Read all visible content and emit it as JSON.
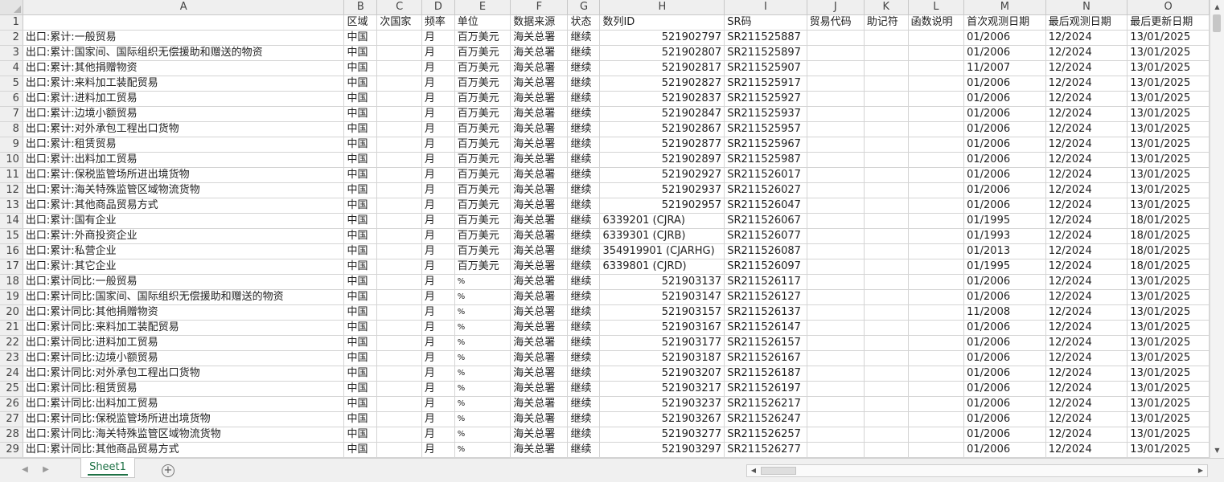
{
  "columns": [
    {
      "letter": "A",
      "header": ""
    },
    {
      "letter": "B",
      "header": "区域"
    },
    {
      "letter": "C",
      "header": "次国家"
    },
    {
      "letter": "D",
      "header": "频率"
    },
    {
      "letter": "E",
      "header": "单位"
    },
    {
      "letter": "F",
      "header": "数据来源"
    },
    {
      "letter": "G",
      "header": "状态"
    },
    {
      "letter": "H",
      "header": "数列ID"
    },
    {
      "letter": "I",
      "header": "SR码"
    },
    {
      "letter": "J",
      "header": "贸易代码"
    },
    {
      "letter": "K",
      "header": "助记符"
    },
    {
      "letter": "L",
      "header": "函数说明"
    },
    {
      "letter": "M",
      "header": "首次观测日期"
    },
    {
      "letter": "N",
      "header": "最后观测日期"
    },
    {
      "letter": "O",
      "header": "最后更新日期"
    }
  ],
  "rows": [
    {
      "n": "2",
      "name": "出口:累计:一般贸易",
      "unit": "百万美元",
      "id": "521902797",
      "sr": "SR211525887",
      "first": "01/2006",
      "updated": "13/01/2025"
    },
    {
      "n": "3",
      "name": "出口:累计:国家间、国际组织无偿援助和赠送的物资",
      "unit": "百万美元",
      "id": "521902807",
      "sr": "SR211525897",
      "first": "01/2006",
      "updated": "13/01/2025"
    },
    {
      "n": "4",
      "name": "出口:累计:其他捐赠物资",
      "unit": "百万美元",
      "id": "521902817",
      "sr": "SR211525907",
      "first": "11/2007",
      "updated": "13/01/2025"
    },
    {
      "n": "5",
      "name": "出口:累计:来料加工装配贸易",
      "unit": "百万美元",
      "id": "521902827",
      "sr": "SR211525917",
      "first": "01/2006",
      "updated": "13/01/2025"
    },
    {
      "n": "6",
      "name": "出口:累计:进料加工贸易",
      "unit": "百万美元",
      "id": "521902837",
      "sr": "SR211525927",
      "first": "01/2006",
      "updated": "13/01/2025"
    },
    {
      "n": "7",
      "name": "出口:累计:边境小额贸易",
      "unit": "百万美元",
      "id": "521902847",
      "sr": "SR211525937",
      "first": "01/2006",
      "updated": "13/01/2025"
    },
    {
      "n": "8",
      "name": "出口:累计:对外承包工程出口货物",
      "unit": "百万美元",
      "id": "521902867",
      "sr": "SR211525957",
      "first": "01/2006",
      "updated": "13/01/2025"
    },
    {
      "n": "9",
      "name": "出口:累计:租赁贸易",
      "unit": "百万美元",
      "id": "521902877",
      "sr": "SR211525967",
      "first": "01/2006",
      "updated": "13/01/2025"
    },
    {
      "n": "10",
      "name": "出口:累计:出料加工贸易",
      "unit": "百万美元",
      "id": "521902897",
      "sr": "SR211525987",
      "first": "01/2006",
      "updated": "13/01/2025"
    },
    {
      "n": "11",
      "name": "出口:累计:保税监管场所进出境货物",
      "unit": "百万美元",
      "id": "521902927",
      "sr": "SR211526017",
      "first": "01/2006",
      "updated": "13/01/2025"
    },
    {
      "n": "12",
      "name": "出口:累计:海关特殊监管区域物流货物",
      "unit": "百万美元",
      "id": "521902937",
      "sr": "SR211526027",
      "first": "01/2006",
      "updated": "13/01/2025"
    },
    {
      "n": "13",
      "name": "出口:累计:其他商品贸易方式",
      "unit": "百万美元",
      "id": "521902957",
      "sr": "SR211526047",
      "first": "01/2006",
      "updated": "13/01/2025"
    },
    {
      "n": "14",
      "name": "出口:累计:国有企业",
      "unit": "百万美元",
      "id": "6339201 (CJRA)",
      "sr": "SR211526067",
      "first": "01/1995",
      "updated": "18/01/2025"
    },
    {
      "n": "15",
      "name": "出口:累计:外商投资企业",
      "unit": "百万美元",
      "id": "6339301 (CJRB)",
      "sr": "SR211526077",
      "first": "01/1993",
      "updated": "18/01/2025"
    },
    {
      "n": "16",
      "name": "出口:累计:私营企业",
      "unit": "百万美元",
      "id": "354919901 (CJARHG)",
      "sr": "SR211526087",
      "first": "01/2013",
      "updated": "18/01/2025"
    },
    {
      "n": "17",
      "name": "出口:累计:其它企业",
      "unit": "百万美元",
      "id": "6339801 (CJRD)",
      "sr": "SR211526097",
      "first": "01/1995",
      "updated": "18/01/2025"
    },
    {
      "n": "18",
      "name": "出口:累计同比:一般贸易",
      "unit": "%",
      "id": "521903137",
      "sr": "SR211526117",
      "first": "01/2006",
      "updated": "13/01/2025"
    },
    {
      "n": "19",
      "name": "出口:累计同比:国家间、国际组织无偿援助和赠送的物资",
      "unit": "%",
      "id": "521903147",
      "sr": "SR211526127",
      "first": "01/2006",
      "updated": "13/01/2025"
    },
    {
      "n": "20",
      "name": "出口:累计同比:其他捐赠物资",
      "unit": "%",
      "id": "521903157",
      "sr": "SR211526137",
      "first": "11/2008",
      "updated": "13/01/2025"
    },
    {
      "n": "21",
      "name": "出口:累计同比:来料加工装配贸易",
      "unit": "%",
      "id": "521903167",
      "sr": "SR211526147",
      "first": "01/2006",
      "updated": "13/01/2025"
    },
    {
      "n": "22",
      "name": "出口:累计同比:进料加工贸易",
      "unit": "%",
      "id": "521903177",
      "sr": "SR211526157",
      "first": "01/2006",
      "updated": "13/01/2025"
    },
    {
      "n": "23",
      "name": "出口:累计同比:边境小额贸易",
      "unit": "%",
      "id": "521903187",
      "sr": "SR211526167",
      "first": "01/2006",
      "updated": "13/01/2025"
    },
    {
      "n": "24",
      "name": "出口:累计同比:对外承包工程出口货物",
      "unit": "%",
      "id": "521903207",
      "sr": "SR211526187",
      "first": "01/2006",
      "updated": "13/01/2025"
    },
    {
      "n": "25",
      "name": "出口:累计同比:租赁贸易",
      "unit": "%",
      "id": "521903217",
      "sr": "SR211526197",
      "first": "01/2006",
      "updated": "13/01/2025"
    },
    {
      "n": "26",
      "name": "出口:累计同比:出料加工贸易",
      "unit": "%",
      "id": "521903237",
      "sr": "SR211526217",
      "first": "01/2006",
      "updated": "13/01/2025"
    },
    {
      "n": "27",
      "name": "出口:累计同比:保税监管场所进出境货物",
      "unit": "%",
      "id": "521903267",
      "sr": "SR211526247",
      "first": "01/2006",
      "updated": "13/01/2025"
    },
    {
      "n": "28",
      "name": "出口:累计同比:海关特殊监管区域物流货物",
      "unit": "%",
      "id": "521903277",
      "sr": "SR211526257",
      "first": "01/2006",
      "updated": "13/01/2025"
    },
    {
      "n": "29",
      "name": "出口:累计同比:其他商品贸易方式",
      "unit": "%",
      "id": "521903297",
      "sr": "SR211526277",
      "first": "01/2006",
      "updated": "13/01/2025"
    }
  ],
  "common": {
    "region": "中国",
    "freq": "月",
    "source": "海关总署",
    "status": "继续",
    "last": "12/2024"
  },
  "sheets": [
    {
      "name": "Sheet1",
      "active": true
    }
  ],
  "icons": {
    "corner": "select-all-triangle-icon",
    "add_sheet": "plus-circle-icon",
    "add_sheet_glyph": "+",
    "prev_sheet_glyph": "◀",
    "next_sheet_glyph": "▶",
    "scroll_up_glyph": "▲",
    "scroll_down_glyph": "▼",
    "scroll_left_glyph": "◀",
    "scroll_right_glyph": "▶"
  },
  "colors": {
    "header_bg": "#efefef",
    "grid_line": "#d4d4d4",
    "sheet_tab_accent": "#1e7145"
  }
}
